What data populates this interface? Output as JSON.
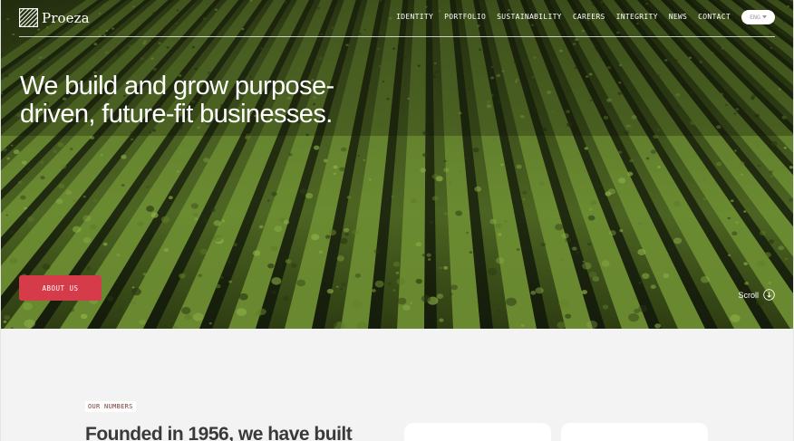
{
  "brand": {
    "name": "Proeza",
    "logo_icon": "diagonal-lines-logo-icon"
  },
  "nav": {
    "items": [
      "IDENTITY",
      "PORTFOLIO",
      "SUSTAINABILITY",
      "CAREERS",
      "INTEGRITY",
      "NEWS",
      "CONTACT"
    ],
    "language": "ENG",
    "language_icon": "caret-down-icon"
  },
  "hero": {
    "headline": "We build and grow purpose-driven, future-fit businesses.",
    "cta_label": "ABOUT US",
    "scroll_label": "Scroll",
    "scroll_icon": "arrow-down-circle-icon"
  },
  "numbers": {
    "tag": "OUR NUMBERS",
    "title": "Founded in 1956, we have built"
  },
  "colors": {
    "accent": "#d63b4a",
    "hero_green": "#3b4e1a",
    "section_bg": "#f3f3f3"
  }
}
